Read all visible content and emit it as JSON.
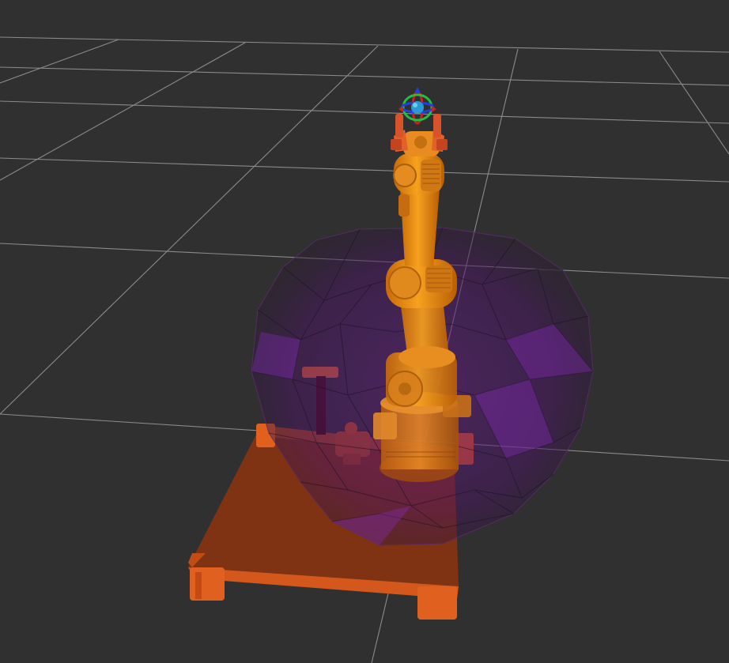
{
  "viewport": {
    "background_color": "#303030",
    "grid_color": "#a0a0a4",
    "robot_color": "#f08c14",
    "platform_color": "#d65a1e",
    "workspace_color": "#7a1fa8",
    "marker_colors": {
      "x_axis": "#d02020",
      "y_axis": "#20c040",
      "z_axis": "#2040e0",
      "center": "#2a9ad0"
    }
  },
  "scene": {
    "objects": [
      {
        "name": "grid-floor",
        "icon": "grid"
      },
      {
        "name": "robot-platform",
        "icon": "table"
      },
      {
        "name": "workspace-reachability-volume",
        "icon": "sphere"
      },
      {
        "name": "robot-arm",
        "icon": "robot-arm"
      },
      {
        "name": "gripper",
        "icon": "gripper"
      },
      {
        "name": "interactive-marker",
        "icon": "pose-marker"
      }
    ]
  }
}
